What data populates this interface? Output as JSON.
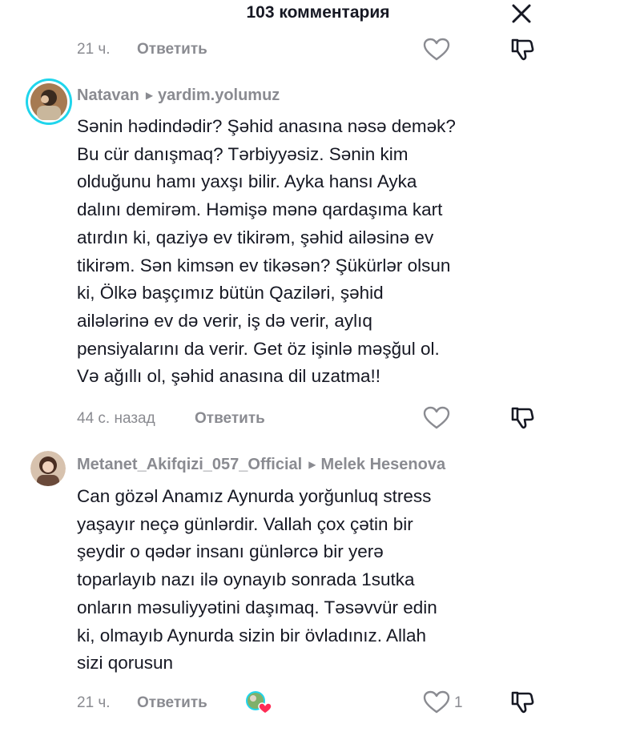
{
  "header": {
    "title": "103 комментария"
  },
  "top_meta": {
    "time": "21 ч.",
    "reply_label": "Ответить"
  },
  "comments": [
    {
      "username": "Natavan",
      "reply_to": "yardim.yolumuz",
      "text": "Sənin hədindədir? Şəhid anasına nəsə demək?\nBu cür danışmaq? Tərbiyyəsiz. Sənin kim\nolduğunu hamı yaxşı bilir. Ayka hansı Ayka\ndalını demirəm. Həmişə mənə qardaşıma kart\natırdın ki, qaziyə ev tikirəm, şəhid ailəsinə ev\ntikirəm. Sən kimsən ev tikəsən? Şükürlər olsun\nki, Ölkə başçımız bütün Qaziləri, şəhid\nailələrinə ev də verir, iş də verir, aylıq\npensiyalarını da verir. Get öz işinlə məşğul ol.\nVə ağıllı ol, şəhid anasına dil uzatma!!",
      "time": "44 с. назад",
      "reply_label": "Ответить"
    },
    {
      "username": "Metanet_Akifqizi_057_Official",
      "reply_to": "Melek Hesenova",
      "text": "Can gözəl Anamız Aynurda yorğunluq stress\nyaşayır neçə günlərdir. Vallah çox çətin bir\nşeydir o qədər insanı günlərcə bir yerə\ntoparlayıb nazı ilə oynayıb sonrada 1sutka\nonların məsuliyyətini daşımaq. Təsəvvür edin\nki, olmayıb Aynurda sizin bir övladınız. Allah\nsizi qorusun",
      "time": "21 ч.",
      "reply_label": "Ответить",
      "like_count": "1"
    }
  ],
  "colors": {
    "text": "#161823",
    "muted": "#8a8b91",
    "avatar_ring": "#20d5ec",
    "heart_badge": "#fe2c55"
  }
}
